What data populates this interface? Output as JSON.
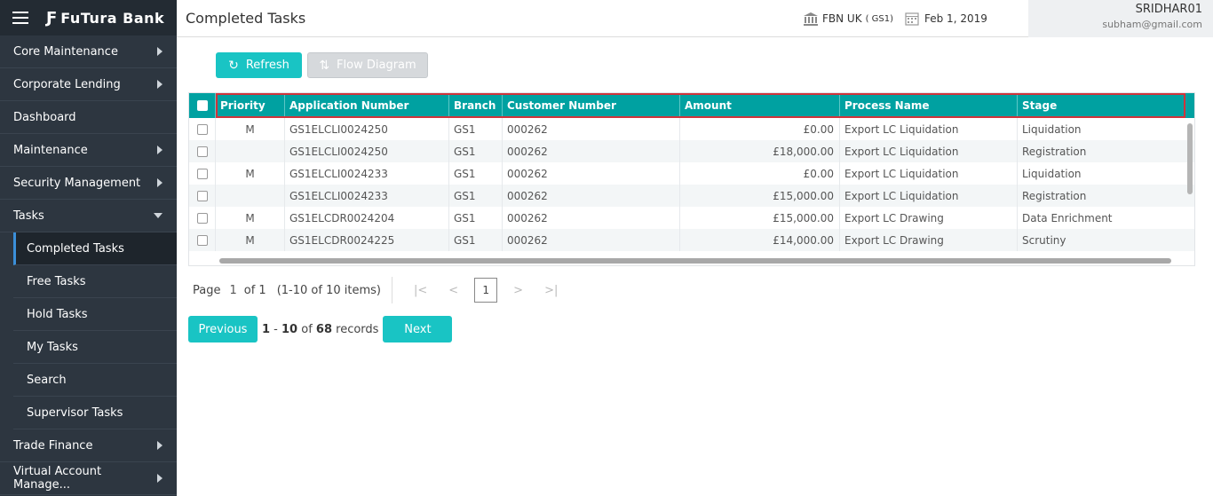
{
  "brand": {
    "name": "FuTura Bank"
  },
  "sidebar": {
    "items": [
      {
        "label": "Core Maintenance"
      },
      {
        "label": "Corporate Lending"
      },
      {
        "label": "Dashboard"
      },
      {
        "label": "Maintenance"
      },
      {
        "label": "Security Management"
      },
      {
        "label": "Tasks"
      },
      {
        "label": "Trade Finance"
      },
      {
        "label": "Virtual Account Manage..."
      }
    ],
    "task_items": [
      {
        "label": "Completed Tasks"
      },
      {
        "label": "Free Tasks"
      },
      {
        "label": "Hold Tasks"
      },
      {
        "label": "My Tasks"
      },
      {
        "label": "Search"
      },
      {
        "label": "Supervisor Tasks"
      }
    ]
  },
  "header": {
    "title": "Completed Tasks",
    "branch": "FBN UK",
    "branch_code": "( GS1)",
    "date": "Feb 1, 2019",
    "user": "SRIDHAR01",
    "email": "subham@gmail.com"
  },
  "toolbar": {
    "refresh": "Refresh",
    "flow": "Flow Diagram"
  },
  "grid": {
    "columns": [
      "Priority",
      "Application Number",
      "Branch",
      "Customer Number",
      "Amount",
      "Process Name",
      "Stage"
    ],
    "rows": [
      [
        "M",
        "GS1ELCLI0024250",
        "GS1",
        "000262",
        "£0.00",
        "Export LC Liquidation",
        "Liquidation"
      ],
      [
        "",
        "GS1ELCLI0024250",
        "GS1",
        "000262",
        "£18,000.00",
        "Export LC Liquidation",
        "Registration"
      ],
      [
        "M",
        "GS1ELCLI0024233",
        "GS1",
        "000262",
        "£0.00",
        "Export LC Liquidation",
        "Liquidation"
      ],
      [
        "",
        "GS1ELCLI0024233",
        "GS1",
        "000262",
        "£15,000.00",
        "Export LC Liquidation",
        "Registration"
      ],
      [
        "M",
        "GS1ELCDR0024204",
        "GS1",
        "000262",
        "£15,000.00",
        "Export LC Drawing",
        "Data Enrichment"
      ],
      [
        "M",
        "GS1ELCDR0024225",
        "GS1",
        "000262",
        "£14,000.00",
        "Export LC Drawing",
        "Scrutiny"
      ]
    ]
  },
  "pager": {
    "page_label": "Page",
    "page": "1",
    "of_label": "of 1",
    "items": "(1-10 of 10 items)",
    "current": "1"
  },
  "records": {
    "prev": "Previous",
    "range_start": "1",
    "dash": " - ",
    "range_end": "10",
    "of": " of ",
    "total": "68",
    "suffix": " records",
    "next": "Next"
  }
}
